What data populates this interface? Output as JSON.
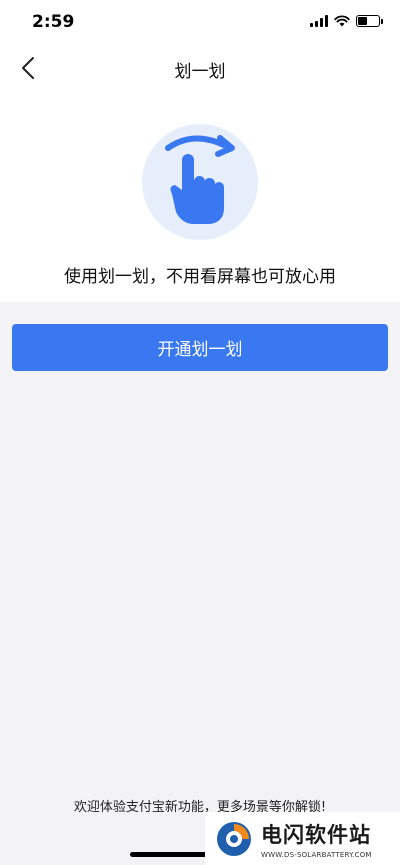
{
  "status_bar": {
    "time": "2:59",
    "icons": [
      "signal-icon",
      "wifi-icon",
      "battery-icon"
    ],
    "battery_level": 0.45
  },
  "nav": {
    "title": "划一划",
    "back_icon": "chevron-left-icon"
  },
  "hero": {
    "illustration": "swipe-hand-icon",
    "caption": "使用划一划，不用看屏幕也可放心用"
  },
  "primary_action": {
    "label": "开通划一划"
  },
  "footer": {
    "text": "欢迎体验支付宝新功能，更多场景等你解锁!"
  },
  "watermark": {
    "name": "电闪软件站",
    "url": "WWW.DS-SOLARBATTERY.COM"
  },
  "colors": {
    "accent": "#3a78f2",
    "hero_circle": "#e6eefb",
    "background": "#f3f3f5"
  }
}
